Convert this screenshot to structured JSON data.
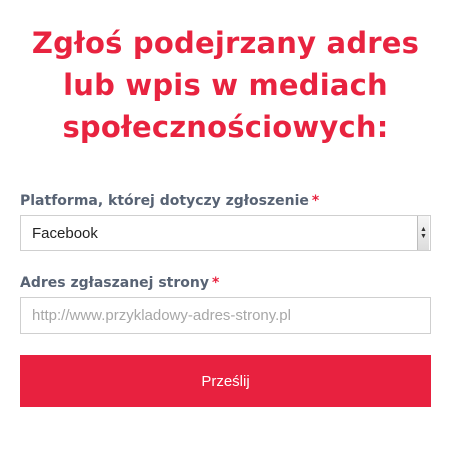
{
  "heading": {
    "line1": "Zgłoś podejrzany adres",
    "line2": "lub wpis w mediach",
    "line3": "społecznościowych:"
  },
  "form": {
    "platform": {
      "label": "Platforma, której dotyczy zgłoszenie",
      "required_mark": "*",
      "selected": "Facebook"
    },
    "address": {
      "label": "Adres zgłaszanej strony",
      "required_mark": "*",
      "value": "",
      "placeholder": "http://www.przykladowy-adres-strony.pl"
    },
    "submit_label": "Prześlij"
  },
  "colors": {
    "accent": "#e8233f",
    "label_text": "#586374",
    "border": "#cfcfcf",
    "placeholder": "#a7a7a7"
  }
}
